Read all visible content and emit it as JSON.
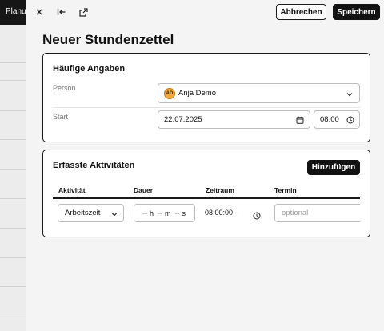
{
  "background": {
    "top_label": "Planun"
  },
  "toolbar": {
    "close_icon": "close-icon",
    "collapse_icon": "collapse-left-icon",
    "external_icon": "external-link-icon",
    "cancel_label": "Abbrechen",
    "save_label": "Speichern"
  },
  "page": {
    "title": "Neuer Stundenzettel"
  },
  "general": {
    "title": "Häufige Angaben",
    "person_label": "Person",
    "person_initials": "AD",
    "person_value": "Anja Demo",
    "start_label": "Start",
    "start_date": "22.07.2025",
    "start_time": "08:00"
  },
  "activities": {
    "title": "Erfasste Aktivitäten",
    "add_label": "Hinzufügen",
    "columns": [
      "Aktivität",
      "Dauer",
      "Zeitraum",
      "Termin"
    ],
    "rows": [
      {
        "activity": "Arbeitszeit",
        "duration_h": "--",
        "duration_h_unit": "h",
        "duration_m": "--",
        "duration_m_unit": "m",
        "duration_s": "--",
        "duration_s_unit": "s",
        "range": "08:00:00 -",
        "appointment_placeholder": "optional"
      }
    ]
  },
  "colors": {
    "accent_dark": "#121212",
    "avatar": "#f2a93b",
    "border": "#1a1a1a"
  }
}
